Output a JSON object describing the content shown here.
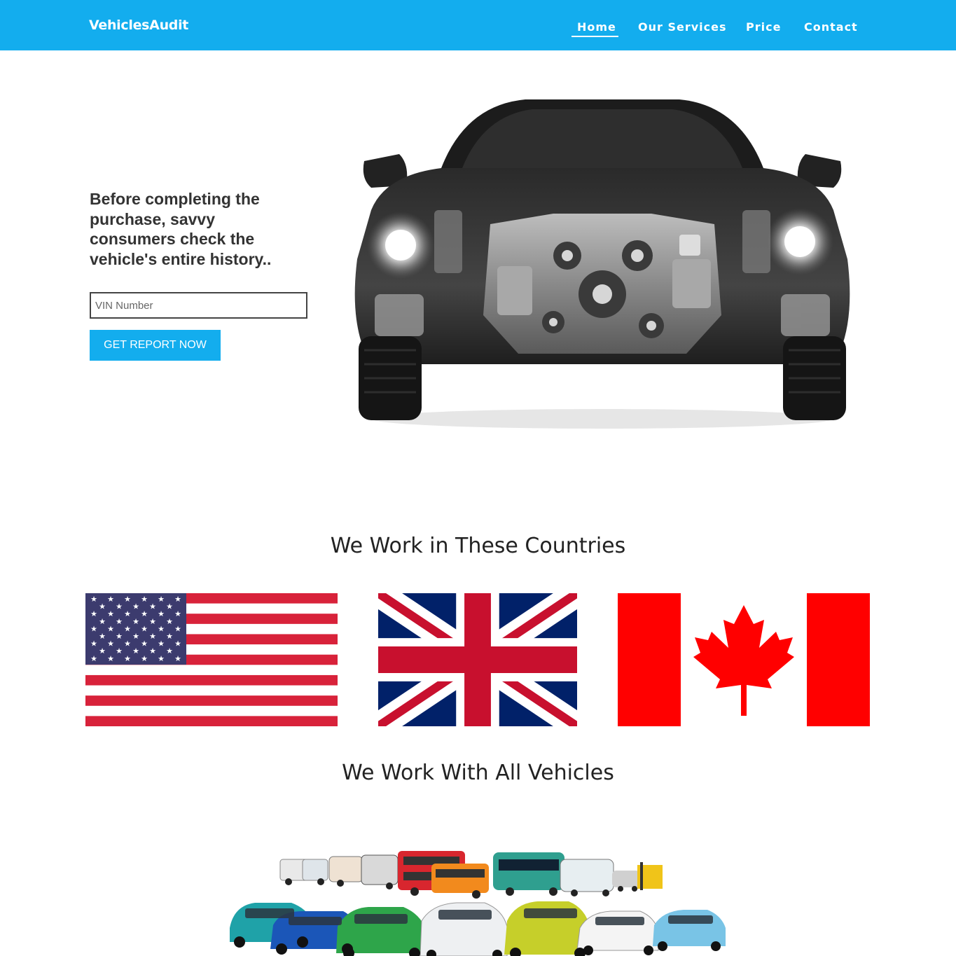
{
  "navbar": {
    "brand": "VehiclesAudit",
    "items": [
      {
        "label": "Home",
        "active": true
      },
      {
        "label": "Our Services"
      },
      {
        "label": "Price"
      },
      {
        "label": "Contact"
      }
    ],
    "background": "#13adee"
  },
  "hero": {
    "headline": "Before completing the purchase, savvy consumers check the vehicle's entire history..",
    "vin_placeholder": "VIN Number",
    "vin_value": "",
    "button_label": "GET REPORT NOW",
    "image": "car-engine-xray-image"
  },
  "countries": {
    "title": "We Work in These Countries",
    "flags": [
      "us-flag",
      "uk-flag",
      "canada-flag"
    ]
  },
  "vehicles": {
    "title": "We Work With All Vehicles",
    "image": "vehicle-fleet-image"
  }
}
